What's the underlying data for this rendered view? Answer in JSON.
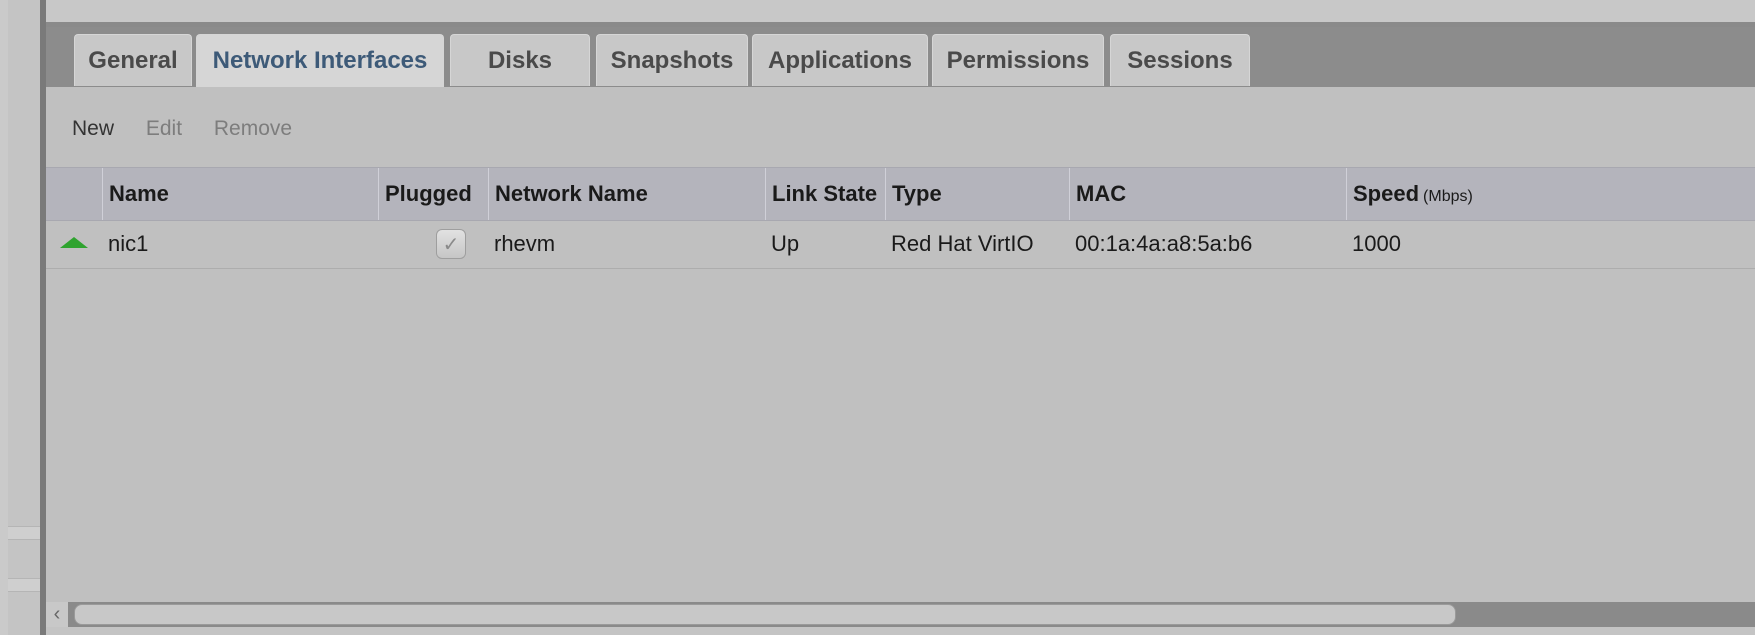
{
  "tabs": [
    {
      "label": "General",
      "active": false
    },
    {
      "label": "Network Interfaces",
      "active": true
    },
    {
      "label": "Disks",
      "active": false
    },
    {
      "label": "Snapshots",
      "active": false
    },
    {
      "label": "Applications",
      "active": false
    },
    {
      "label": "Permissions",
      "active": false
    },
    {
      "label": "Sessions",
      "active": false
    }
  ],
  "toolbar": {
    "new_label": "New",
    "edit_label": "Edit",
    "remove_label": "Remove"
  },
  "grid": {
    "columns": {
      "name": "Name",
      "plugged": "Plugged",
      "network_name": "Network Name",
      "link_state": "Link State",
      "type": "Type",
      "mac": "MAC",
      "speed": "Speed",
      "speed_unit": "(Mbps)"
    },
    "rows": [
      {
        "status_icon": "up-arrow-icon",
        "name": "nic1",
        "plugged": true,
        "network_name": "rhevm",
        "link_state": "Up",
        "type": "Red Hat VirtIO",
        "mac": "00:1a:4a:a8:5a:b6",
        "speed": "1000"
      }
    ]
  },
  "colors": {
    "active_tab_text": "#3d5a78",
    "status_up": "#2fa32f"
  }
}
